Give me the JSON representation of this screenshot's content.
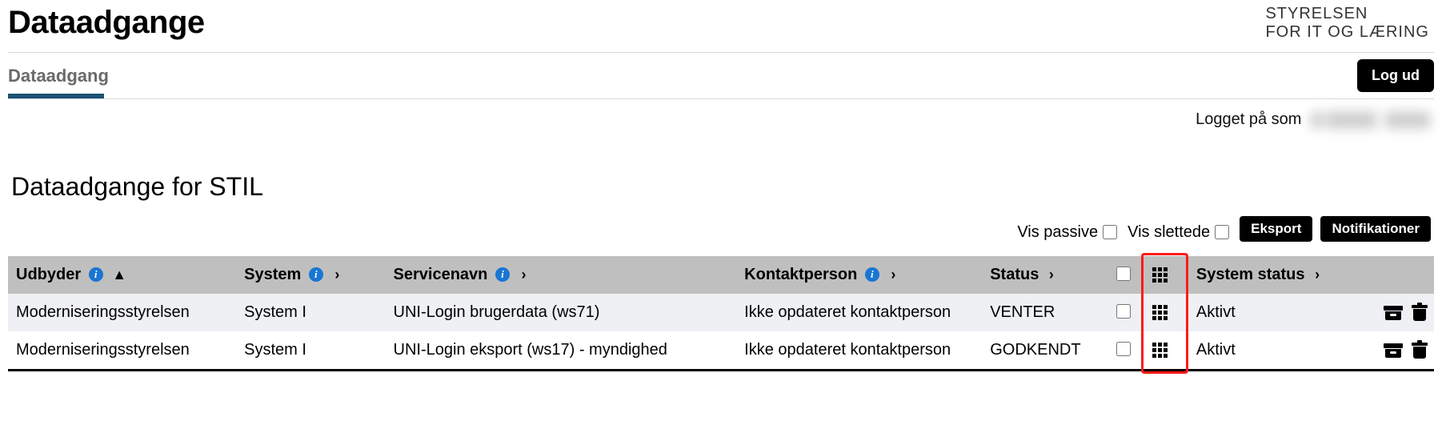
{
  "header": {
    "title": "Dataadgange",
    "brand_line1": "STYRELSEN",
    "brand_line2": "FOR IT OG LÆRING"
  },
  "tabs": {
    "active": "Dataadgang",
    "logout_label": "Log ud"
  },
  "login_status": {
    "prefix": "Logget på som"
  },
  "section": {
    "title": "Dataadgange for STIL"
  },
  "filters": {
    "show_passive_label": "Vis passive",
    "show_deleted_label": "Vis slettede",
    "export_label": "Eksport",
    "notifications_label": "Notifikationer"
  },
  "columns": {
    "provider": "Udbyder",
    "system": "System",
    "service": "Servicenavn",
    "contact": "Kontaktperson",
    "status": "Status",
    "system_status": "System status"
  },
  "rows": [
    {
      "provider": "Moderniseringsstyrelsen",
      "system": "System I",
      "service": "UNI-Login brugerdata (ws71)",
      "contact": "Ikke opdateret kontaktperson",
      "status": "VENTER",
      "system_status": "Aktivt"
    },
    {
      "provider": "Moderniseringsstyrelsen",
      "system": "System I",
      "service": "UNI-Login eksport (ws17) - myndighed",
      "contact": "Ikke opdateret kontaktperson",
      "status": "GODKENDT",
      "system_status": "Aktivt"
    }
  ]
}
